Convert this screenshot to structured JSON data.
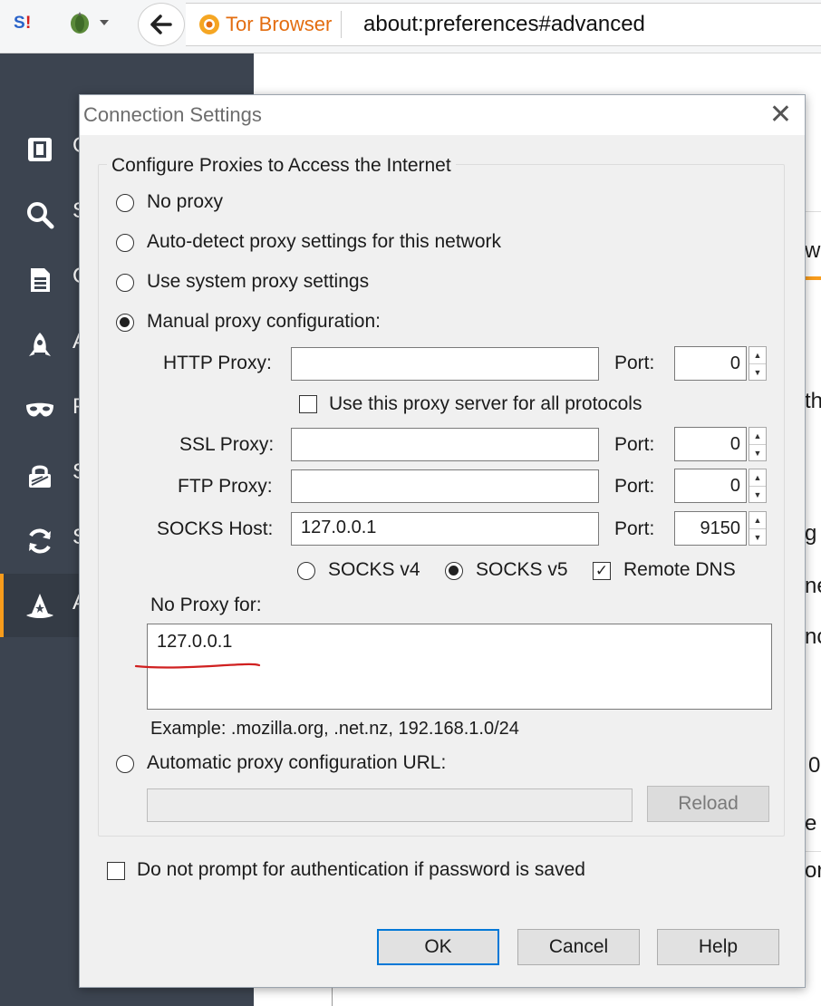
{
  "browser": {
    "identity_label": "Tor Browser",
    "url": "about:preferences#advanced"
  },
  "sidebar": {
    "items": [
      {
        "icon": "general-icon",
        "label": "G"
      },
      {
        "icon": "search-icon",
        "label": "S"
      },
      {
        "icon": "content-icon",
        "label": "C"
      },
      {
        "icon": "applications-icon",
        "label": "A"
      },
      {
        "icon": "privacy-mask-icon",
        "label": "P"
      },
      {
        "icon": "security-lock-icon",
        "label": "S"
      },
      {
        "icon": "sync-icon",
        "label": "S"
      },
      {
        "icon": "advanced-wizard-icon",
        "label": "A"
      }
    ]
  },
  "background_peek": [
    "wo",
    "th",
    "g",
    "ne",
    "nc",
    "0",
    "e",
    "or"
  ],
  "dialog": {
    "title": "Connection Settings",
    "group_title": "Configure Proxies to Access the Internet",
    "options": {
      "no_proxy": "No proxy",
      "auto_detect": "Auto-detect proxy settings for this network",
      "system": "Use system proxy settings",
      "manual": "Manual proxy configuration:",
      "auto_url": "Automatic proxy configuration URL:"
    },
    "http_label": "HTTP Proxy:",
    "http_value": "",
    "http_port": "0",
    "same_proxy_label": "Use this proxy server for all protocols",
    "ssl_label": "SSL Proxy:",
    "ssl_value": "",
    "ssl_port": "0",
    "ftp_label": "FTP Proxy:",
    "ftp_value": "",
    "ftp_port": "0",
    "socks_label": "SOCKS Host:",
    "socks_value": "127.0.0.1",
    "socks_port": "9150",
    "port_label": "Port:",
    "socks_v4": "SOCKS v4",
    "socks_v5": "SOCKS v5",
    "remote_dns": "Remote DNS",
    "no_proxy_for_label": "No Proxy for:",
    "no_proxy_for_value": "127.0.0.1",
    "example": "Example: .mozilla.org, .net.nz, 192.168.1.0/24",
    "auto_url_value": "",
    "reload": "Reload",
    "no_prompt_auth": "Do not prompt for authentication if password is saved",
    "ok": "OK",
    "cancel": "Cancel",
    "help": "Help"
  },
  "colors": {
    "sidebar_bg": "#3c4450",
    "accent_orange": "#f89c1c",
    "default_button_border": "#0078d7",
    "annotation_red": "#d02020"
  }
}
